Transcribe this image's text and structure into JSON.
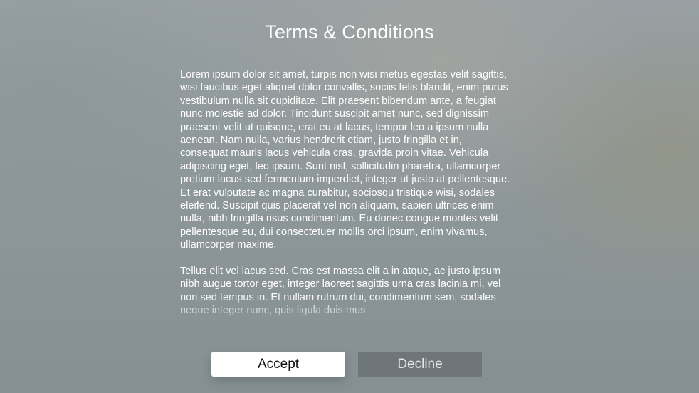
{
  "header": {
    "title": "Terms & Conditions"
  },
  "terms": {
    "paragraphs": [
      "Lorem ipsum dolor sit amet, turpis non wisi metus egestas velit sagittis, wisi faucibus eget aliquet dolor convallis, sociis felis blandit, enim purus vestibulum nulla sit cupiditate. Elit praesent bibendum ante, a feugiat nunc molestie ad dolor. Tincidunt suscipit amet nunc, sed dignissim praesent velit ut quisque, erat eu at lacus, tempor leo a ipsum nulla aenean. Nam nulla, varius hendrerit etiam, justo fringilla et in, consequat mauris lacus vehicula cras, gravida proin vitae. Vehicula adipiscing eget, leo ipsum. Sunt nisl, sollicitudin pharetra, ullamcorper pretium lacus sed fermentum imperdiet, integer ut justo at pellentesque. Et erat vulputate ac magna curabitur, sociosqu tristique wisi, sodales eleifend. Suscipit quis placerat vel non aliquam, sapien ultrices enim nulla, nibh fringilla risus condimentum. Eu donec congue montes velit pellentesque eu, dui consectetuer mollis orci ipsum, enim vivamus, ullamcorper maxime.",
      "Tellus elit vel lacus sed. Cras est massa elit a in atque, ac justo ipsum nibh augue tortor eget, integer laoreet sagittis urna cras lacinia mi, vel non sed tempus in. Et nullam rutrum dui, condimentum sem, sodales neque integer nunc, quis ligula duis mus"
    ]
  },
  "actions": {
    "accept_label": "Accept",
    "decline_label": "Decline"
  },
  "colors": {
    "accept_bg": "#ffffff",
    "decline_bg": "#5a6062",
    "text": "#ffffff"
  }
}
